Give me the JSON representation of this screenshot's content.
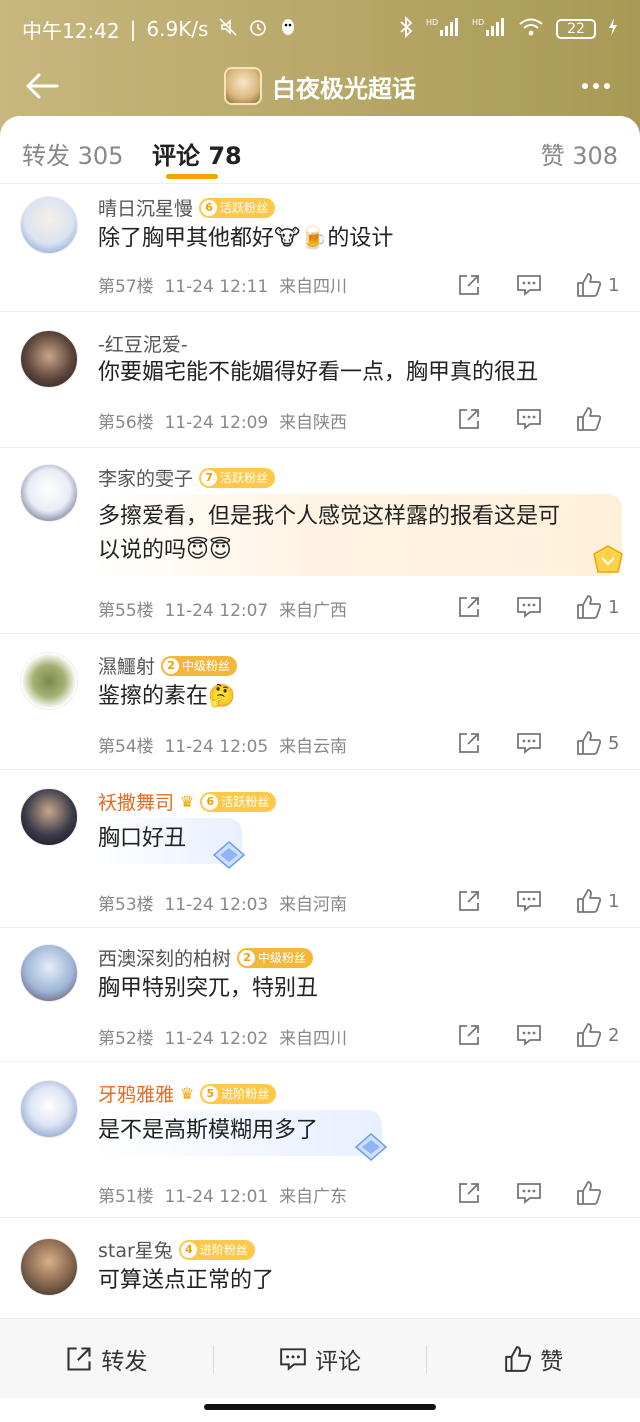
{
  "status": {
    "time": "中午12:42",
    "speed": "6.9K/s",
    "battery": "22",
    "signal_label_1": "HD",
    "signal_label_2": "HD"
  },
  "nav": {
    "title": "白夜极光超话"
  },
  "tabs": {
    "repost": "转发 305",
    "comment": "评论 78",
    "like": "赞 308"
  },
  "comments": [
    {
      "user": "晴日沉星慢",
      "badge_level": "6",
      "badge_text": "活跃粉丝",
      "text": "除了胸甲其他都好🐮🍺的设计",
      "floor": "第57楼",
      "time": "11-24 12:11",
      "loc": "来自四川",
      "likes": "1"
    },
    {
      "user": "-红豆泥爱-",
      "text": "你要媚宅能不能媚得好看一点，胸甲真的很丑",
      "floor": "第56楼",
      "time": "11-24 12:09",
      "loc": "来自陕西",
      "likes": ""
    },
    {
      "user": "李家的雯子",
      "badge_level": "7",
      "badge_text": "活跃粉丝",
      "text_line1": "多擦爱看，但是我个人感觉这样露的报看这是可",
      "text_line2": "以说的吗😇😇",
      "floor": "第55楼",
      "time": "11-24 12:07",
      "loc": "来自广西",
      "likes": "1"
    },
    {
      "user": "濕鱷射",
      "badge_level": "2",
      "badge_text": "中级粉丝",
      "text": "鉴擦的素在🤔",
      "floor": "第54楼",
      "time": "11-24 12:05",
      "loc": "来自云南",
      "likes": "5"
    },
    {
      "user": "袄撒舞司",
      "badge_level": "6",
      "badge_text": "活跃粉丝",
      "text": "胸口好丑",
      "floor": "第53楼",
      "time": "11-24 12:03",
      "loc": "来自河南",
      "likes": "1"
    },
    {
      "user": "西澳深刻的柏树",
      "badge_level": "2",
      "badge_text": "中级粉丝",
      "text": "胸甲特别突兀，特别丑",
      "floor": "第52楼",
      "time": "11-24 12:02",
      "loc": "来自四川",
      "likes": "2"
    },
    {
      "user": "牙鸦雅雅",
      "badge_level": "5",
      "badge_text": "进阶粉丝",
      "text": "是不是高斯模糊用多了",
      "floor": "第51楼",
      "time": "11-24 12:01",
      "loc": "来自广东",
      "likes": ""
    },
    {
      "user": "star星兔",
      "badge_level": "4",
      "badge_text": "进阶粉丝",
      "text": "可算送点正常的了"
    }
  ],
  "bottom": {
    "repost": "转发",
    "comment": "评论",
    "like": "赞"
  },
  "colors": {
    "accent": "#f7a200",
    "header_gradient_start": "#c8b77e",
    "header_gradient_end": "#a89a55",
    "vip_name": "#e86a1c"
  }
}
